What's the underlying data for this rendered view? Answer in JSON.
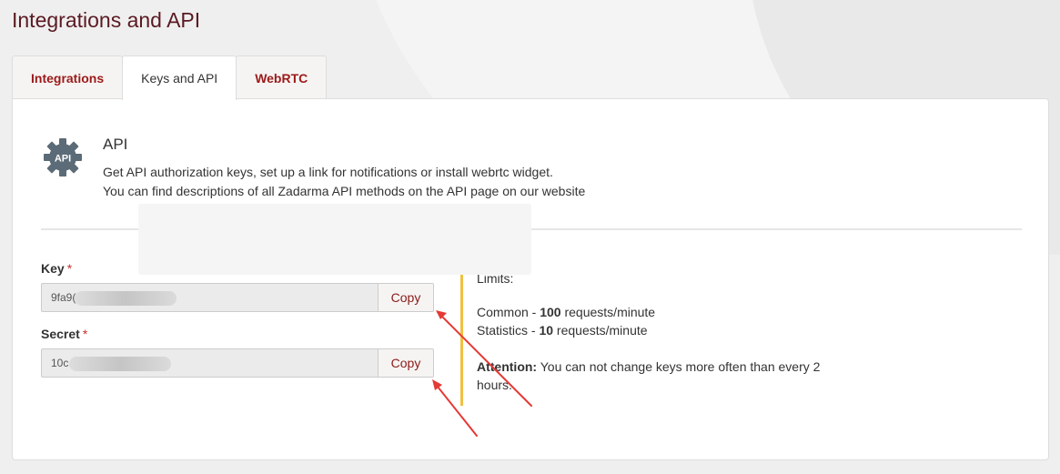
{
  "page": {
    "title": "Integrations and API"
  },
  "tabs": [
    {
      "label": "Integrations",
      "active": false
    },
    {
      "label": "Keys and API",
      "active": true
    },
    {
      "label": "WebRTC",
      "active": false
    }
  ],
  "api": {
    "icon_text": "API",
    "heading": "API",
    "desc_line1": "Get API authorization keys, set up a link for notifications or install webrtc widget.",
    "desc_line2": "You can find descriptions of all Zadarma API methods on the API page on our website"
  },
  "key_field": {
    "label": "Key",
    "required_mark": "*",
    "value_visible": "9fa9(",
    "copy_label": "Copy"
  },
  "secret_field": {
    "label": "Secret",
    "required_mark": "*",
    "value_visible": "10c",
    "copy_label": "Copy"
  },
  "limits": {
    "title": "Limits:",
    "common_prefix": "Common - ",
    "common_value": "100",
    "common_suffix": " requests/minute",
    "stats_prefix": "Statistics - ",
    "stats_value": "10",
    "stats_suffix": " requests/minute",
    "attention_label": "Attention:",
    "attention_line1": " You can not change keys more often than every 2",
    "attention_line2": "hours."
  },
  "colors": {
    "accent": "#9b1a1a",
    "title": "#5a1a22",
    "limits_bar": "#f0c040",
    "arrow": "#e53935",
    "icon_gear": "#5b6b77"
  }
}
